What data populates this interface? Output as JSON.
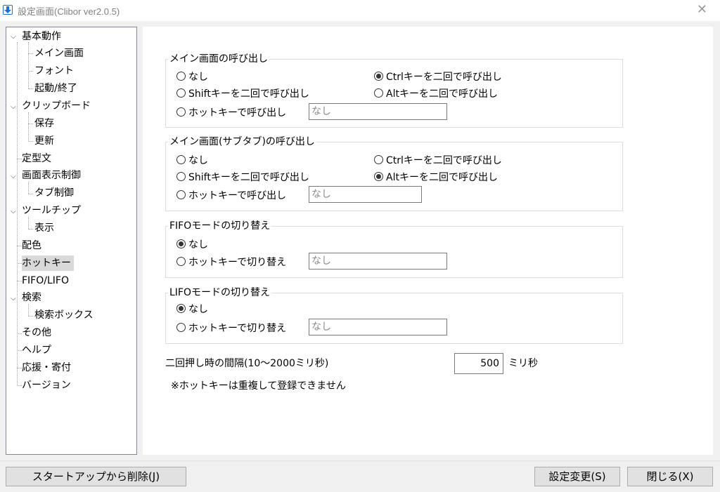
{
  "window": {
    "title": "設定画面(Clibor ver2.0.5)",
    "close_glyph": "✕"
  },
  "tree": {
    "items": [
      {
        "label": "基本動作",
        "expanded": true
      },
      {
        "label": "メイン画面"
      },
      {
        "label": "フォント"
      },
      {
        "label": "起動/終了"
      },
      {
        "label": "クリップボード",
        "expanded": true
      },
      {
        "label": "保存"
      },
      {
        "label": "更新"
      },
      {
        "label": "定型文"
      },
      {
        "label": "画面表示制御",
        "expanded": true
      },
      {
        "label": "タブ制御"
      },
      {
        "label": "ツールチップ",
        "expanded": true
      },
      {
        "label": "表示"
      },
      {
        "label": "配色"
      },
      {
        "label": "ホットキー",
        "selected": true
      },
      {
        "label": "FIFO/LIFO"
      },
      {
        "label": "検索",
        "expanded": true
      },
      {
        "label": "検索ボックス"
      },
      {
        "label": "その他"
      },
      {
        "label": "ヘルプ"
      },
      {
        "label": "応援・寄付"
      },
      {
        "label": "バージョン"
      }
    ],
    "expander_glyph": "⌵"
  },
  "groups": {
    "main_call": {
      "title": "メイン画面の呼び出し",
      "opt_none": "なし",
      "opt_ctrl": "Ctrlキーを二回で呼び出し",
      "opt_shift": "Shiftキーを二回で呼び出し",
      "opt_alt": "Altキーを二回で呼び出し",
      "opt_hotkey": "ホットキーで呼び出し",
      "hotkey_value": "なし",
      "selected": "ctrl"
    },
    "sub_call": {
      "title": "メイン画面(サブタブ)の呼び出し",
      "opt_none": "なし",
      "opt_ctrl": "Ctrlキーを二回で呼び出し",
      "opt_shift": "Shiftキーを二回で呼び出し",
      "opt_alt": "Altキーを二回で呼び出し",
      "opt_hotkey": "ホットキーで呼び出し",
      "hotkey_value": "なし",
      "selected": "alt"
    },
    "fifo": {
      "title": "FIFOモードの切り替え",
      "opt_none": "なし",
      "opt_hotkey": "ホットキーで切り替え",
      "hotkey_value": "なし",
      "selected": "none"
    },
    "lifo": {
      "title": "LIFOモードの切り替え",
      "opt_none": "なし",
      "opt_hotkey": "ホットキーで切り替え",
      "hotkey_value": "なし",
      "selected": "none"
    }
  },
  "interval": {
    "label": "二回押し時の間隔(10～2000ミリ秒)",
    "value": "500",
    "unit": "ミリ秒"
  },
  "note": "※ホットキーは重複して登録できません",
  "footer": {
    "startup_remove": "スタートアップから削除(J)",
    "apply": "設定変更(S)",
    "close": "閉じる(X)"
  }
}
